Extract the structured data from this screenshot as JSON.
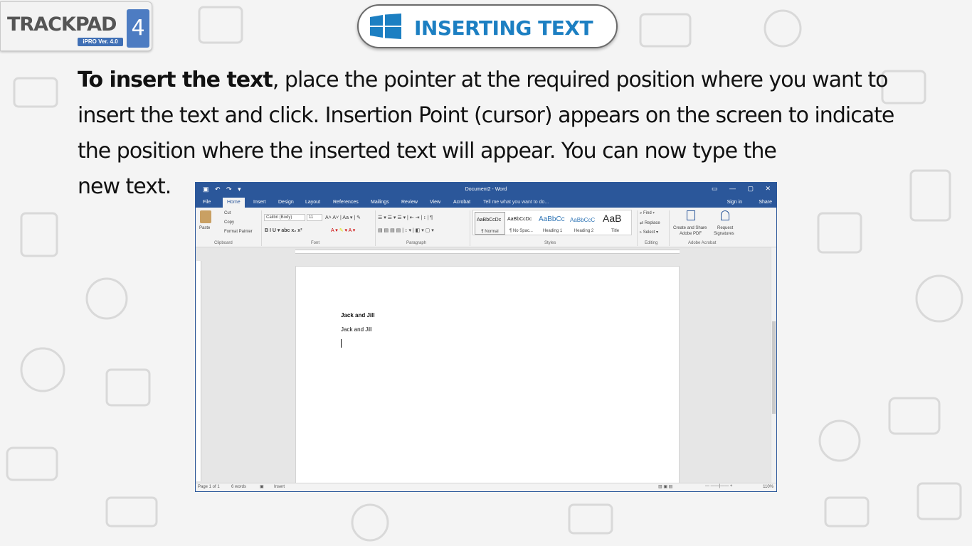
{
  "logo": {
    "brand": "TRACKPAD",
    "version": "iPRO Ver. 4.0",
    "number": "4"
  },
  "header": {
    "title": "INSERTING TEXT"
  },
  "instruction": {
    "bold": "To insert the text",
    "rest": ", place the pointer at the required position where you want to insert the text and click. Insertion Point (cursor) appears on the screen to indicate the position where the inserted text will appear. You can now type the",
    "last": "new text."
  },
  "word": {
    "document_title": "Document2 - Word",
    "tabs": [
      "File",
      "Home",
      "Insert",
      "Design",
      "Layout",
      "References",
      "Mailings",
      "Review",
      "View",
      "Acrobat"
    ],
    "tell_me": "Tell me what you want to do...",
    "sign_in": "Sign in",
    "share": "Share",
    "clipboard": {
      "paste": "Paste",
      "cut": "Cut",
      "copy": "Copy",
      "format_painter": "Format Painter",
      "label": "Clipboard"
    },
    "font": {
      "name": "Calibri (Body)",
      "size": "11",
      "label": "Font"
    },
    "paragraph_label": "Paragraph",
    "styles": {
      "label": "Styles",
      "items": [
        {
          "sample": "AaBbCcDc",
          "name": "¶ Normal"
        },
        {
          "sample": "AaBbCcDc",
          "name": "¶ No Spac..."
        },
        {
          "sample": "AaBbCc",
          "name": "Heading 1"
        },
        {
          "sample": "AaBbCcC",
          "name": "Heading 2"
        },
        {
          "sample": "AaB",
          "name": "Title"
        }
      ]
    },
    "editing": {
      "find": "Find",
      "replace": "Replace",
      "select": "Select",
      "label": "Editing"
    },
    "acrobat": {
      "create1": "Create and Share",
      "create2": "Adobe PDF",
      "request1": "Request",
      "request2": "Signatures",
      "label": "Adobe Acrobat"
    },
    "document": {
      "line1": "Jack and Jill",
      "line2": "Jack and Jill"
    },
    "status": {
      "page": "Page 1 of 1",
      "words": "6 words",
      "mode": "Insert",
      "zoom": "110%"
    },
    "colors": {
      "accent": "#2b579a"
    }
  }
}
